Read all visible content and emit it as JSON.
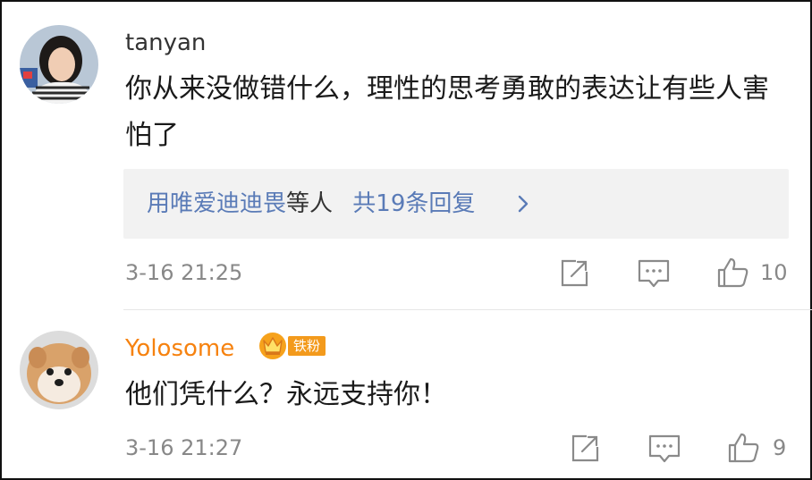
{
  "comments": [
    {
      "username": "tanyan",
      "content": "你从来没做错什么，理性的思考勇敢的表达让有些人害怕了",
      "replies": {
        "names": "用唯爱迪迪畏",
        "suffix": "等人",
        "count": "共19条回复"
      },
      "time": "3-16 21:25",
      "likes": "10"
    },
    {
      "username": "Yolosome",
      "badge": "铁粉",
      "content": "他们凭什么？永远支持你！",
      "time": "3-16 21:27",
      "likes": "9"
    }
  ],
  "colors": {
    "link_blue": "#5a7bb7",
    "vip_orange": "#f6820f",
    "badge_orange": "#f39a1c",
    "meta_gray": "#888888"
  },
  "icons": [
    "share-icon",
    "comment-icon",
    "like-icon",
    "chevron-right-icon",
    "crown-icon"
  ]
}
